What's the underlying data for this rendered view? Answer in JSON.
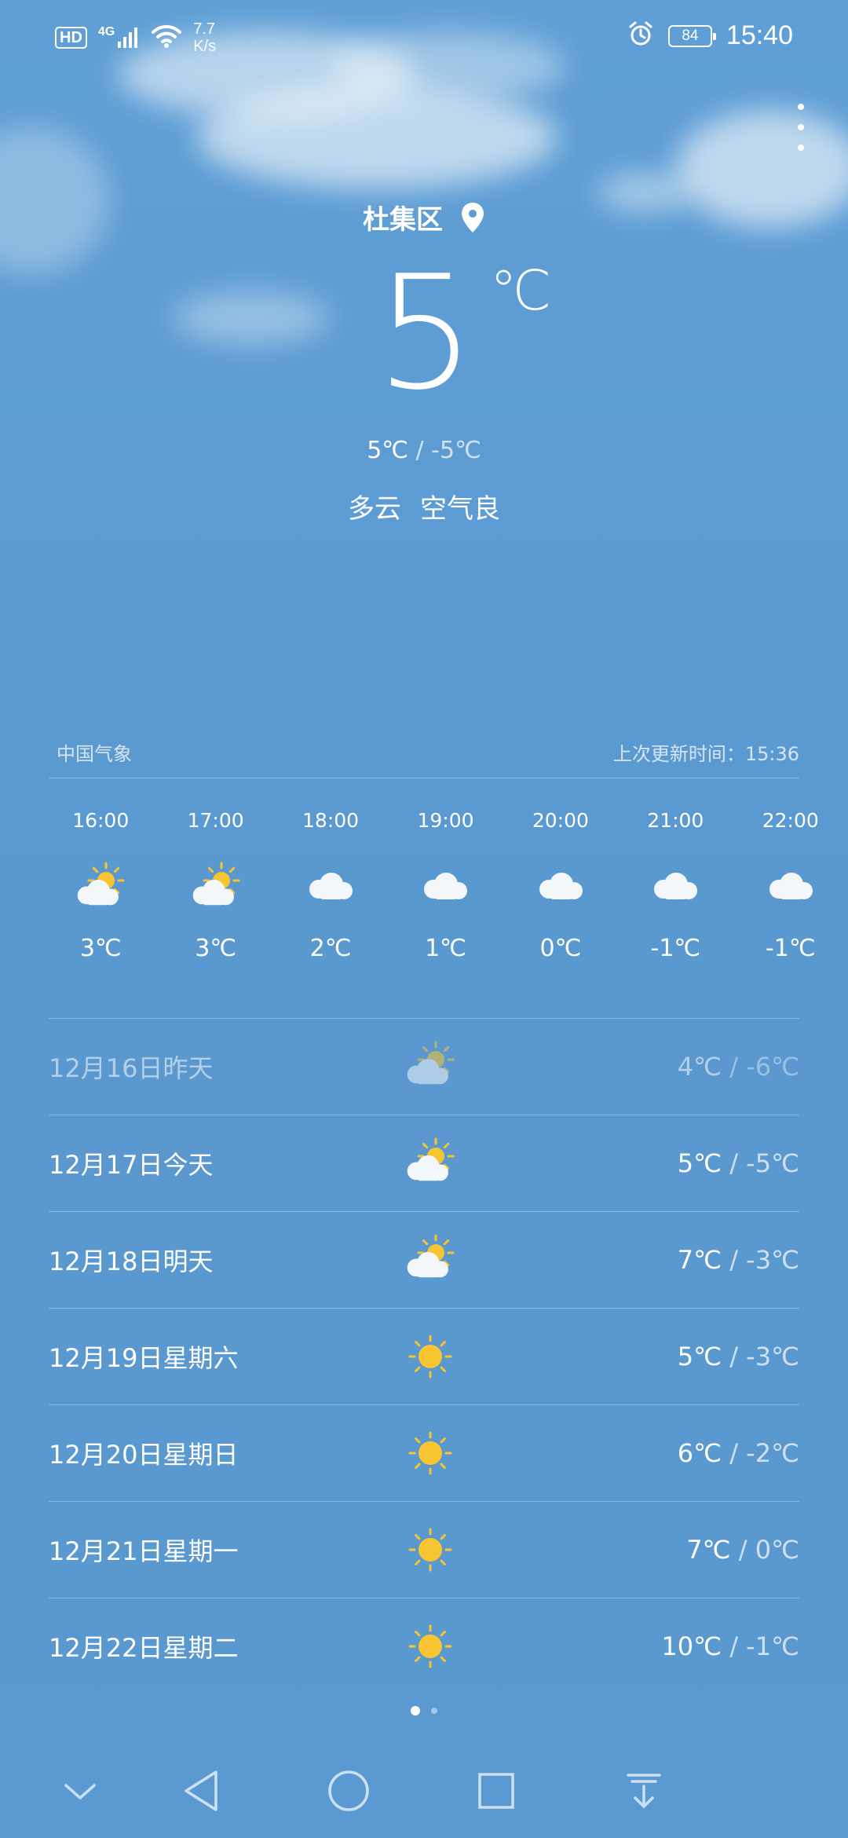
{
  "status_bar": {
    "hd": "HD",
    "network": "4G",
    "speed_value": "7.7",
    "speed_unit": "K/s",
    "battery": "84",
    "time": "15:40"
  },
  "current": {
    "location": "杜集区",
    "temp": "5",
    "unit": "℃",
    "high": "5℃",
    "low": " / -5℃",
    "condition": "多云",
    "air": "空气良"
  },
  "source": {
    "provider": "中国气象",
    "updated": "上次更新时间：15:36"
  },
  "hourly": [
    {
      "time": "16:00",
      "icon": "partly-cloudy-icon",
      "temp": "3℃"
    },
    {
      "time": "17:00",
      "icon": "partly-cloudy-icon",
      "temp": "3℃"
    },
    {
      "time": "18:00",
      "icon": "cloud-icon",
      "temp": "2℃"
    },
    {
      "time": "19:00",
      "icon": "cloud-icon",
      "temp": "1℃"
    },
    {
      "time": "20:00",
      "icon": "cloud-icon",
      "temp": "0℃"
    },
    {
      "time": "21:00",
      "icon": "cloud-icon",
      "temp": "-1℃"
    },
    {
      "time": "22:00",
      "icon": "cloud-icon",
      "temp": "-1℃"
    }
  ],
  "daily": [
    {
      "date": "12月16日昨天",
      "icon": "partly-cloudy-icon",
      "high": "4℃",
      "low": " / -6℃",
      "past": true
    },
    {
      "date": "12月17日今天",
      "icon": "partly-cloudy-icon",
      "high": "5℃",
      "low": " / -5℃"
    },
    {
      "date": "12月18日明天",
      "icon": "partly-cloudy-icon",
      "high": "7℃",
      "low": " / -3℃"
    },
    {
      "date": "12月19日星期六",
      "icon": "sun-icon",
      "high": "5℃",
      "low": " / -3℃"
    },
    {
      "date": "12月20日星期日",
      "icon": "sun-icon",
      "high": "6℃",
      "low": " / -2℃"
    },
    {
      "date": "12月21日星期一",
      "icon": "sun-icon",
      "high": "7℃",
      "low": " / 0℃"
    },
    {
      "date": "12月22日星期二",
      "icon": "sun-icon",
      "high": "10℃",
      "low": " / -1℃"
    }
  ],
  "pager": {
    "pages": 2,
    "active": 1
  },
  "colors": {
    "sun": "#f7c531",
    "sky": "#5b9ad2"
  }
}
